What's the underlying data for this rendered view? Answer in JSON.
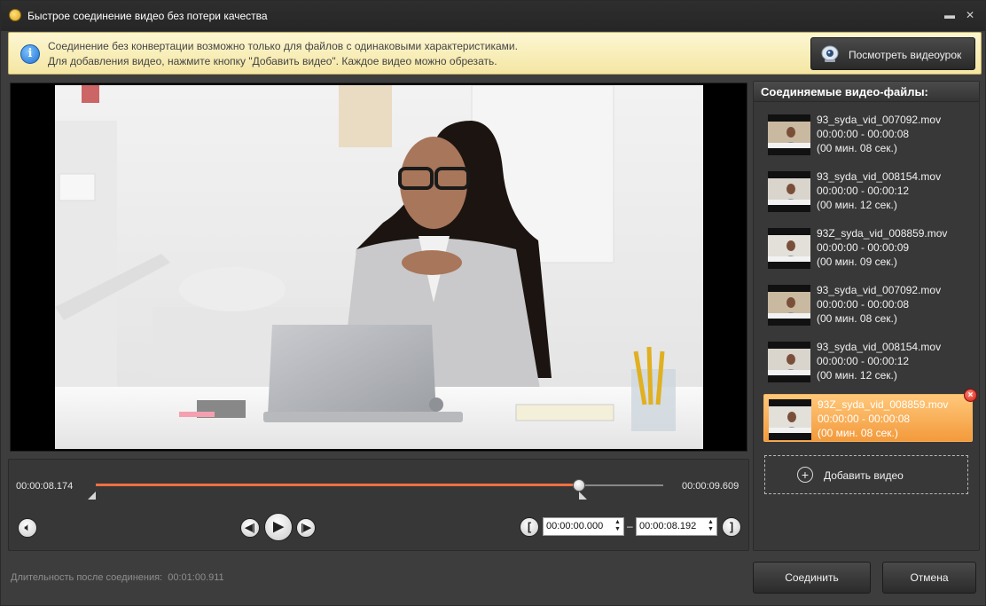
{
  "window": {
    "title": "Быстрое соединение видео без потери качества"
  },
  "info": {
    "line1": "Соединение без конвертации возможно только для файлов с одинаковыми характеристиками.",
    "line2": "Для добавления видео, нажмите кнопку \"Добавить видео\". Каждое видео можно обрезать.",
    "tutorial_label": "Посмотреть видеоурок"
  },
  "player": {
    "current_time": "00:00:08.174",
    "total_time": "00:00:09.609",
    "progress": 0.851,
    "trim_start_position": 0.0,
    "trim_end_position": 0.852,
    "trim_start": "00:00:00.000",
    "trim_end": "00:00:08.192",
    "range_separator": "–"
  },
  "sidebar": {
    "header": "Соединяемые видео-файлы:",
    "clips": [
      {
        "name": "93_syda_vid_007092.mov",
        "range": "00:00:00 - 00:00:08",
        "duration": "(00 мин. 08 сек.)",
        "selected": false
      },
      {
        "name": "93_syda_vid_008154.mov",
        "range": "00:00:00 - 00:00:12",
        "duration": "(00 мин. 12 сек.)",
        "selected": false
      },
      {
        "name": "93Z_syda_vid_008859.mov",
        "range": "00:00:00 - 00:00:09",
        "duration": "(00 мин. 09 сек.)",
        "selected": false
      },
      {
        "name": "93_syda_vid_007092.mov",
        "range": "00:00:00 - 00:00:08",
        "duration": "(00 мин. 08 сек.)",
        "selected": false
      },
      {
        "name": "93_syda_vid_008154.mov",
        "range": "00:00:00 - 00:00:12",
        "duration": "(00 мин. 12 сек.)",
        "selected": false
      },
      {
        "name": "93Z_syda_vid_008859.mov",
        "range": "00:00:00 - 00:00:08",
        "duration": "(00 мин. 08 сек.)",
        "selected": true
      }
    ],
    "add_label": "Добавить видео"
  },
  "footer": {
    "duration_label": "Длительность после соединения:",
    "duration_value": "00:01:00.911",
    "join_label": "Соединить",
    "cancel_label": "Отмена"
  },
  "colors": {
    "accent": "#f07040",
    "selected_clip": "#f39a3c",
    "info_bar": "#f4e6a3"
  }
}
